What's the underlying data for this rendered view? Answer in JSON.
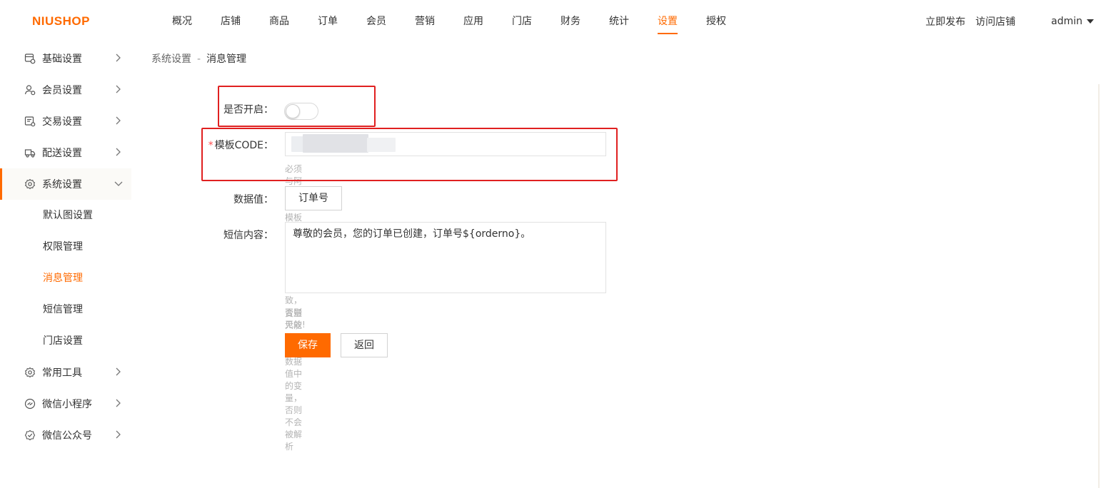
{
  "brand": {
    "logo_text": "NIUSHOP",
    "accent": "#ff6a00"
  },
  "topnav": {
    "items": [
      "概况",
      "店铺",
      "商品",
      "订单",
      "会员",
      "营销",
      "应用",
      "门店",
      "财务",
      "统计",
      "设置",
      "授权"
    ],
    "active": "设置"
  },
  "header_right": {
    "publish": "立即发布",
    "visit": "访问店铺",
    "user": "admin"
  },
  "sidebar": {
    "items": [
      {
        "label": "基础设置",
        "icon": "settings-grid-icon"
      },
      {
        "label": "会员设置",
        "icon": "user-gear-icon"
      },
      {
        "label": "交易设置",
        "icon": "receipt-gear-icon"
      },
      {
        "label": "配送设置",
        "icon": "truck-icon"
      },
      {
        "label": "系统设置",
        "icon": "gear-icon"
      },
      {
        "label": "常用工具",
        "icon": "gear-icon"
      },
      {
        "label": "微信小程序",
        "icon": "mini-program-icon"
      },
      {
        "label": "微信公众号",
        "icon": "check-badge-icon"
      }
    ],
    "system_sub": [
      "默认图设置",
      "权限管理",
      "消息管理",
      "短信管理",
      "门店设置"
    ],
    "active_sub": "消息管理"
  },
  "breadcrumb": {
    "parent": "系统设置",
    "separator": "-",
    "current": "消息管理"
  },
  "form": {
    "enable_label": "是否开启：",
    "enabled": false,
    "template_label": "模板CODE：",
    "required_mark": "*",
    "template_value": "",
    "template_hint": "必须与阿里云短信模板中要使用的模版CODE一致，否则无效!",
    "data_label": "数据值：",
    "data_tag": "订单号",
    "content_label": "短信内容：",
    "content_value": "尊敬的会员，您的订单已创建，订单号${orderno}。",
    "content_hint": "变量只能使用上方数据值中的变量，否则不会被解析",
    "save": "保存",
    "back": "返回"
  }
}
